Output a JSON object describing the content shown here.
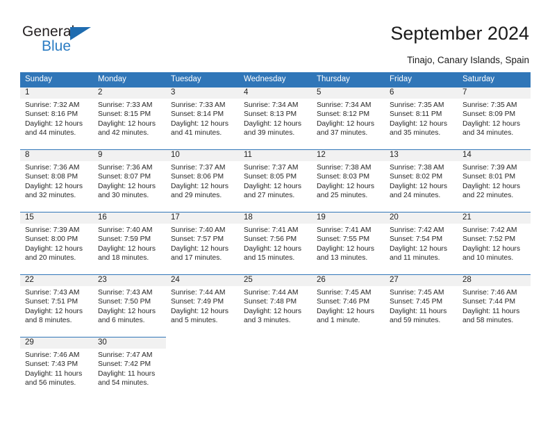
{
  "brand": {
    "name_top": "General",
    "name_bottom": "Blue",
    "accent_color": "#2b7cc3",
    "triangle_color": "#1f6cb0"
  },
  "header": {
    "title": "September 2024",
    "subtitle": "Tinajo, Canary Islands, Spain"
  },
  "theme": {
    "header_blue": "#3076b8",
    "band_gray": "#f1f1f1",
    "text": "#262626"
  },
  "calendar": {
    "weekday_headers": [
      "Sunday",
      "Monday",
      "Tuesday",
      "Wednesday",
      "Thursday",
      "Friday",
      "Saturday"
    ],
    "weeks": [
      [
        {
          "day": "1",
          "sunrise": "Sunrise: 7:32 AM",
          "sunset": "Sunset: 8:16 PM",
          "daylight1": "Daylight: 12 hours",
          "daylight2": "and 44 minutes."
        },
        {
          "day": "2",
          "sunrise": "Sunrise: 7:33 AM",
          "sunset": "Sunset: 8:15 PM",
          "daylight1": "Daylight: 12 hours",
          "daylight2": "and 42 minutes."
        },
        {
          "day": "3",
          "sunrise": "Sunrise: 7:33 AM",
          "sunset": "Sunset: 8:14 PM",
          "daylight1": "Daylight: 12 hours",
          "daylight2": "and 41 minutes."
        },
        {
          "day": "4",
          "sunrise": "Sunrise: 7:34 AM",
          "sunset": "Sunset: 8:13 PM",
          "daylight1": "Daylight: 12 hours",
          "daylight2": "and 39 minutes."
        },
        {
          "day": "5",
          "sunrise": "Sunrise: 7:34 AM",
          "sunset": "Sunset: 8:12 PM",
          "daylight1": "Daylight: 12 hours",
          "daylight2": "and 37 minutes."
        },
        {
          "day": "6",
          "sunrise": "Sunrise: 7:35 AM",
          "sunset": "Sunset: 8:11 PM",
          "daylight1": "Daylight: 12 hours",
          "daylight2": "and 35 minutes."
        },
        {
          "day": "7",
          "sunrise": "Sunrise: 7:35 AM",
          "sunset": "Sunset: 8:09 PM",
          "daylight1": "Daylight: 12 hours",
          "daylight2": "and 34 minutes."
        }
      ],
      [
        {
          "day": "8",
          "sunrise": "Sunrise: 7:36 AM",
          "sunset": "Sunset: 8:08 PM",
          "daylight1": "Daylight: 12 hours",
          "daylight2": "and 32 minutes."
        },
        {
          "day": "9",
          "sunrise": "Sunrise: 7:36 AM",
          "sunset": "Sunset: 8:07 PM",
          "daylight1": "Daylight: 12 hours",
          "daylight2": "and 30 minutes."
        },
        {
          "day": "10",
          "sunrise": "Sunrise: 7:37 AM",
          "sunset": "Sunset: 8:06 PM",
          "daylight1": "Daylight: 12 hours",
          "daylight2": "and 29 minutes."
        },
        {
          "day": "11",
          "sunrise": "Sunrise: 7:37 AM",
          "sunset": "Sunset: 8:05 PM",
          "daylight1": "Daylight: 12 hours",
          "daylight2": "and 27 minutes."
        },
        {
          "day": "12",
          "sunrise": "Sunrise: 7:38 AM",
          "sunset": "Sunset: 8:03 PM",
          "daylight1": "Daylight: 12 hours",
          "daylight2": "and 25 minutes."
        },
        {
          "day": "13",
          "sunrise": "Sunrise: 7:38 AM",
          "sunset": "Sunset: 8:02 PM",
          "daylight1": "Daylight: 12 hours",
          "daylight2": "and 24 minutes."
        },
        {
          "day": "14",
          "sunrise": "Sunrise: 7:39 AM",
          "sunset": "Sunset: 8:01 PM",
          "daylight1": "Daylight: 12 hours",
          "daylight2": "and 22 minutes."
        }
      ],
      [
        {
          "day": "15",
          "sunrise": "Sunrise: 7:39 AM",
          "sunset": "Sunset: 8:00 PM",
          "daylight1": "Daylight: 12 hours",
          "daylight2": "and 20 minutes."
        },
        {
          "day": "16",
          "sunrise": "Sunrise: 7:40 AM",
          "sunset": "Sunset: 7:59 PM",
          "daylight1": "Daylight: 12 hours",
          "daylight2": "and 18 minutes."
        },
        {
          "day": "17",
          "sunrise": "Sunrise: 7:40 AM",
          "sunset": "Sunset: 7:57 PM",
          "daylight1": "Daylight: 12 hours",
          "daylight2": "and 17 minutes."
        },
        {
          "day": "18",
          "sunrise": "Sunrise: 7:41 AM",
          "sunset": "Sunset: 7:56 PM",
          "daylight1": "Daylight: 12 hours",
          "daylight2": "and 15 minutes."
        },
        {
          "day": "19",
          "sunrise": "Sunrise: 7:41 AM",
          "sunset": "Sunset: 7:55 PM",
          "daylight1": "Daylight: 12 hours",
          "daylight2": "and 13 minutes."
        },
        {
          "day": "20",
          "sunrise": "Sunrise: 7:42 AM",
          "sunset": "Sunset: 7:54 PM",
          "daylight1": "Daylight: 12 hours",
          "daylight2": "and 11 minutes."
        },
        {
          "day": "21",
          "sunrise": "Sunrise: 7:42 AM",
          "sunset": "Sunset: 7:52 PM",
          "daylight1": "Daylight: 12 hours",
          "daylight2": "and 10 minutes."
        }
      ],
      [
        {
          "day": "22",
          "sunrise": "Sunrise: 7:43 AM",
          "sunset": "Sunset: 7:51 PM",
          "daylight1": "Daylight: 12 hours",
          "daylight2": "and 8 minutes."
        },
        {
          "day": "23",
          "sunrise": "Sunrise: 7:43 AM",
          "sunset": "Sunset: 7:50 PM",
          "daylight1": "Daylight: 12 hours",
          "daylight2": "and 6 minutes."
        },
        {
          "day": "24",
          "sunrise": "Sunrise: 7:44 AM",
          "sunset": "Sunset: 7:49 PM",
          "daylight1": "Daylight: 12 hours",
          "daylight2": "and 5 minutes."
        },
        {
          "day": "25",
          "sunrise": "Sunrise: 7:44 AM",
          "sunset": "Sunset: 7:48 PM",
          "daylight1": "Daylight: 12 hours",
          "daylight2": "and 3 minutes."
        },
        {
          "day": "26",
          "sunrise": "Sunrise: 7:45 AM",
          "sunset": "Sunset: 7:46 PM",
          "daylight1": "Daylight: 12 hours",
          "daylight2": "and 1 minute."
        },
        {
          "day": "27",
          "sunrise": "Sunrise: 7:45 AM",
          "sunset": "Sunset: 7:45 PM",
          "daylight1": "Daylight: 11 hours",
          "daylight2": "and 59 minutes."
        },
        {
          "day": "28",
          "sunrise": "Sunrise: 7:46 AM",
          "sunset": "Sunset: 7:44 PM",
          "daylight1": "Daylight: 11 hours",
          "daylight2": "and 58 minutes."
        }
      ],
      [
        {
          "day": "29",
          "sunrise": "Sunrise: 7:46 AM",
          "sunset": "Sunset: 7:43 PM",
          "daylight1": "Daylight: 11 hours",
          "daylight2": "and 56 minutes."
        },
        {
          "day": "30",
          "sunrise": "Sunrise: 7:47 AM",
          "sunset": "Sunset: 7:42 PM",
          "daylight1": "Daylight: 11 hours",
          "daylight2": "and 54 minutes."
        },
        {
          "day": "",
          "sunrise": "",
          "sunset": "",
          "daylight1": "",
          "daylight2": ""
        },
        {
          "day": "",
          "sunrise": "",
          "sunset": "",
          "daylight1": "",
          "daylight2": ""
        },
        {
          "day": "",
          "sunrise": "",
          "sunset": "",
          "daylight1": "",
          "daylight2": ""
        },
        {
          "day": "",
          "sunrise": "",
          "sunset": "",
          "daylight1": "",
          "daylight2": ""
        },
        {
          "day": "",
          "sunrise": "",
          "sunset": "",
          "daylight1": "",
          "daylight2": ""
        }
      ]
    ]
  }
}
